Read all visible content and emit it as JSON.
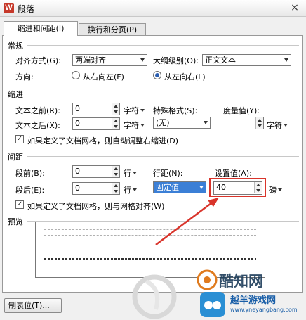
{
  "window": {
    "title": "段落",
    "app_icon_letter": "W",
    "close_glyph": "×"
  },
  "tabs": [
    {
      "label": "缩进和间距(I)",
      "active": true
    },
    {
      "label": "换行和分页(P)",
      "active": false
    }
  ],
  "general": {
    "section_label": "常规",
    "alignment_label": "对齐方式(G):",
    "alignment_value": "两端对齐",
    "outline_label": "大纲级别(O):",
    "outline_value": "正文文本",
    "direction_label": "方向:",
    "rtl_label": "从右向左(F)",
    "ltr_label": "从左向右(L)",
    "direction_selected": "ltr"
  },
  "indent": {
    "section_label": "缩进",
    "before_label": "文本之前(R):",
    "before_value": "0",
    "before_unit": "字符",
    "after_label": "文本之后(X):",
    "after_value": "0",
    "after_unit": "字符",
    "special_label": "特殊格式(S):",
    "special_value": "(无)",
    "measure_label": "度量值(Y):",
    "measure_value": "",
    "measure_unit": "字符",
    "grid_checkbox_label": "如果定义了文档网格，则自动调整右缩进(D)",
    "grid_checkbox_checked": true
  },
  "spacing": {
    "section_label": "间距",
    "before_label": "段前(B):",
    "before_value": "0",
    "before_unit": "行",
    "after_label": "段后(E):",
    "after_value": "0",
    "after_unit": "行",
    "line_spacing_label": "行距(N):",
    "line_spacing_value": "固定值",
    "set_value_label": "设置值(A):",
    "set_value": "40",
    "set_value_unit": "磅",
    "grid_checkbox_label": "如果定义了文档网格，则与网格对齐(W)",
    "grid_checkbox_checked": true
  },
  "preview": {
    "section_label": "预览"
  },
  "footer": {
    "tabstop_button": "制表位(T)..."
  },
  "colors": {
    "highlight": "#d9342b",
    "selection": "#3b7fd6"
  },
  "watermark": {
    "brand_text": "酷知网",
    "site_text": "越羊游戏网",
    "site_url": "www.yneyangbang.com"
  }
}
